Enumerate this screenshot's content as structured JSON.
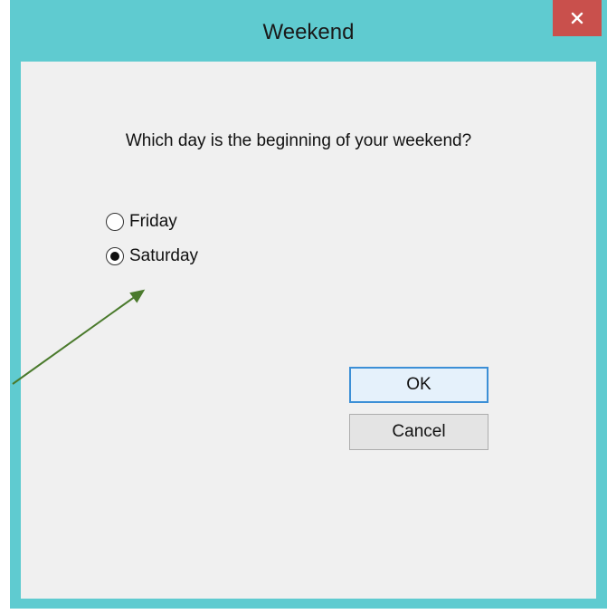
{
  "window": {
    "title": "Weekend",
    "close_symbol": "✕"
  },
  "dialog": {
    "question": "Which day is the beginning of your weekend?",
    "options": [
      {
        "label": "Friday",
        "selected": false
      },
      {
        "label": "Saturday",
        "selected": true
      }
    ],
    "ok_label": "OK",
    "cancel_label": "Cancel"
  },
  "annotation": {
    "arrow_color": "#4a7a2c"
  }
}
